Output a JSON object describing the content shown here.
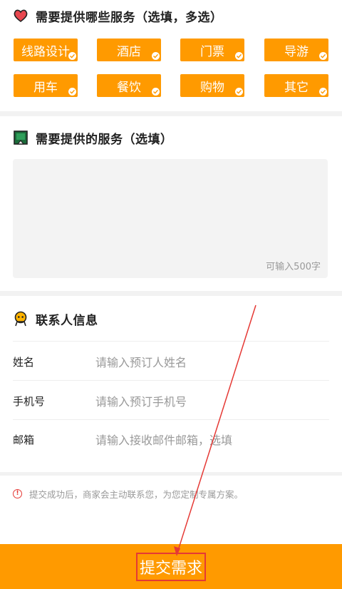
{
  "services_section": {
    "title": "需要提供哪些服务（选填，多选）",
    "tags": [
      "线路设计",
      "酒店",
      "门票",
      "导游",
      "用车",
      "餐饮",
      "购物",
      "其它"
    ]
  },
  "detail_section": {
    "title": "需要提供的服务（选填）",
    "textarea_hint": "可输入500字"
  },
  "contact_section": {
    "title": "联系人信息",
    "rows": [
      {
        "label": "姓名",
        "placeholder": "请输入预订人姓名"
      },
      {
        "label": "手机号",
        "placeholder": "请输入预订手机号"
      },
      {
        "label": "邮箱",
        "placeholder": "请输入接收邮件邮箱，选填"
      }
    ]
  },
  "notice": "提交成功后，商家会主动联系您，为您定制专属方案。",
  "submit_label": "提交需求",
  "colors": {
    "accent": "#ff9a00",
    "annotation": "#e53935"
  },
  "icons": {
    "services": "heart-icon",
    "detail": "flag-icon",
    "contact": "person-icon",
    "notice": "warning-icon"
  }
}
